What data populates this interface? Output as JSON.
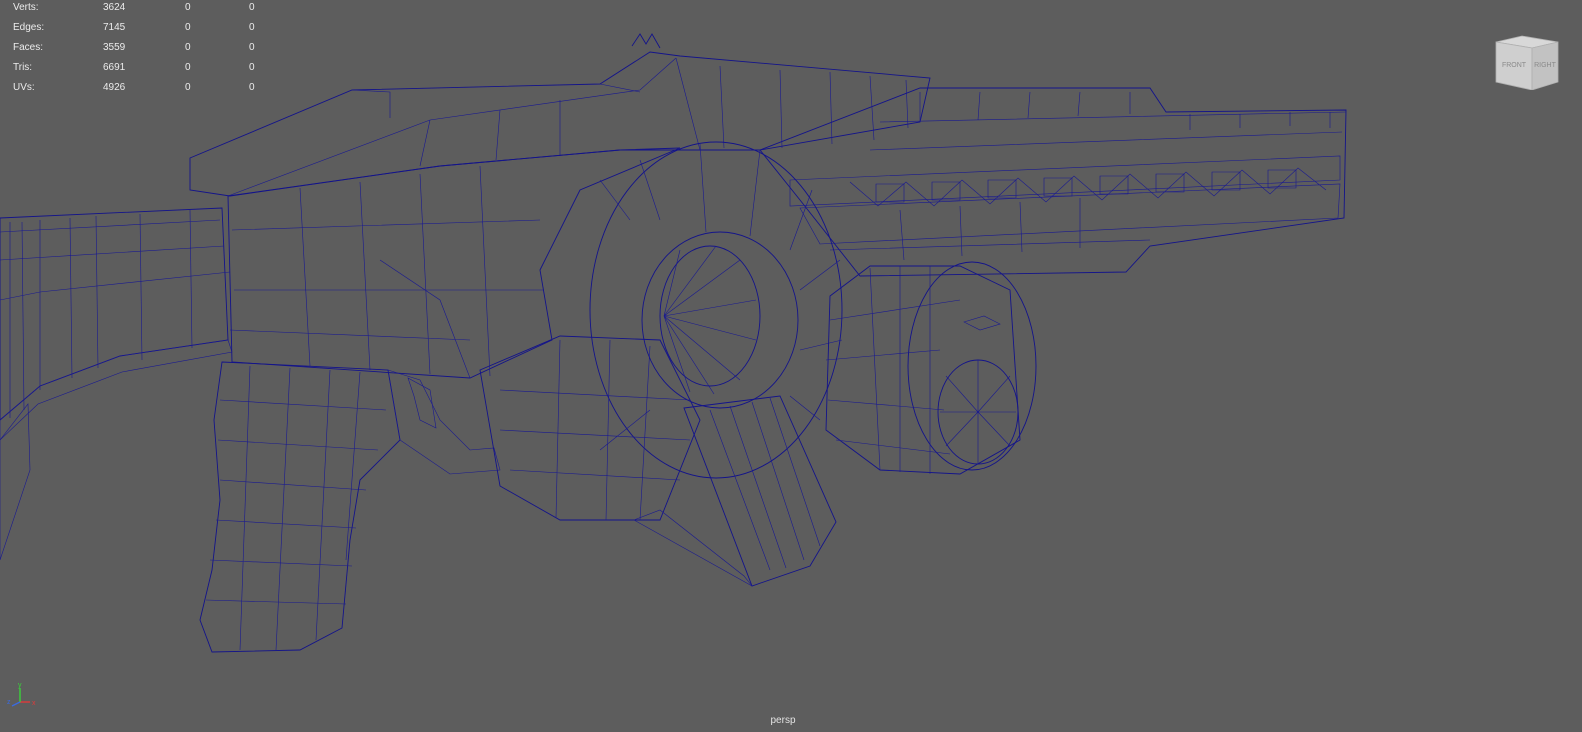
{
  "hud": {
    "rows": [
      {
        "label": "Verts:",
        "value": "3624",
        "c2": "0",
        "c3": "0"
      },
      {
        "label": "Edges:",
        "value": "7145",
        "c2": "0",
        "c3": "0"
      },
      {
        "label": "Faces:",
        "value": "3559",
        "c2": "0",
        "c3": "0"
      },
      {
        "label": "Tris:",
        "value": "6691",
        "c2": "0",
        "c3": "0"
      },
      {
        "label": "UVs:",
        "value": "4926",
        "c2": "0",
        "c3": "0"
      }
    ]
  },
  "viewcube": {
    "front": "FRONT",
    "right": "RIGHT"
  },
  "axis": {
    "x": "x",
    "y": "y",
    "z": "z"
  },
  "camera": {
    "name": "persp"
  },
  "colors": {
    "background": "#5d5d5d",
    "wireframe": "#14148a",
    "surface": "#a6a6a6",
    "hud_text": "#ececec",
    "axis_x": "#e03a3a",
    "axis_y": "#3ad23a",
    "axis_z": "#3a6ae0"
  }
}
